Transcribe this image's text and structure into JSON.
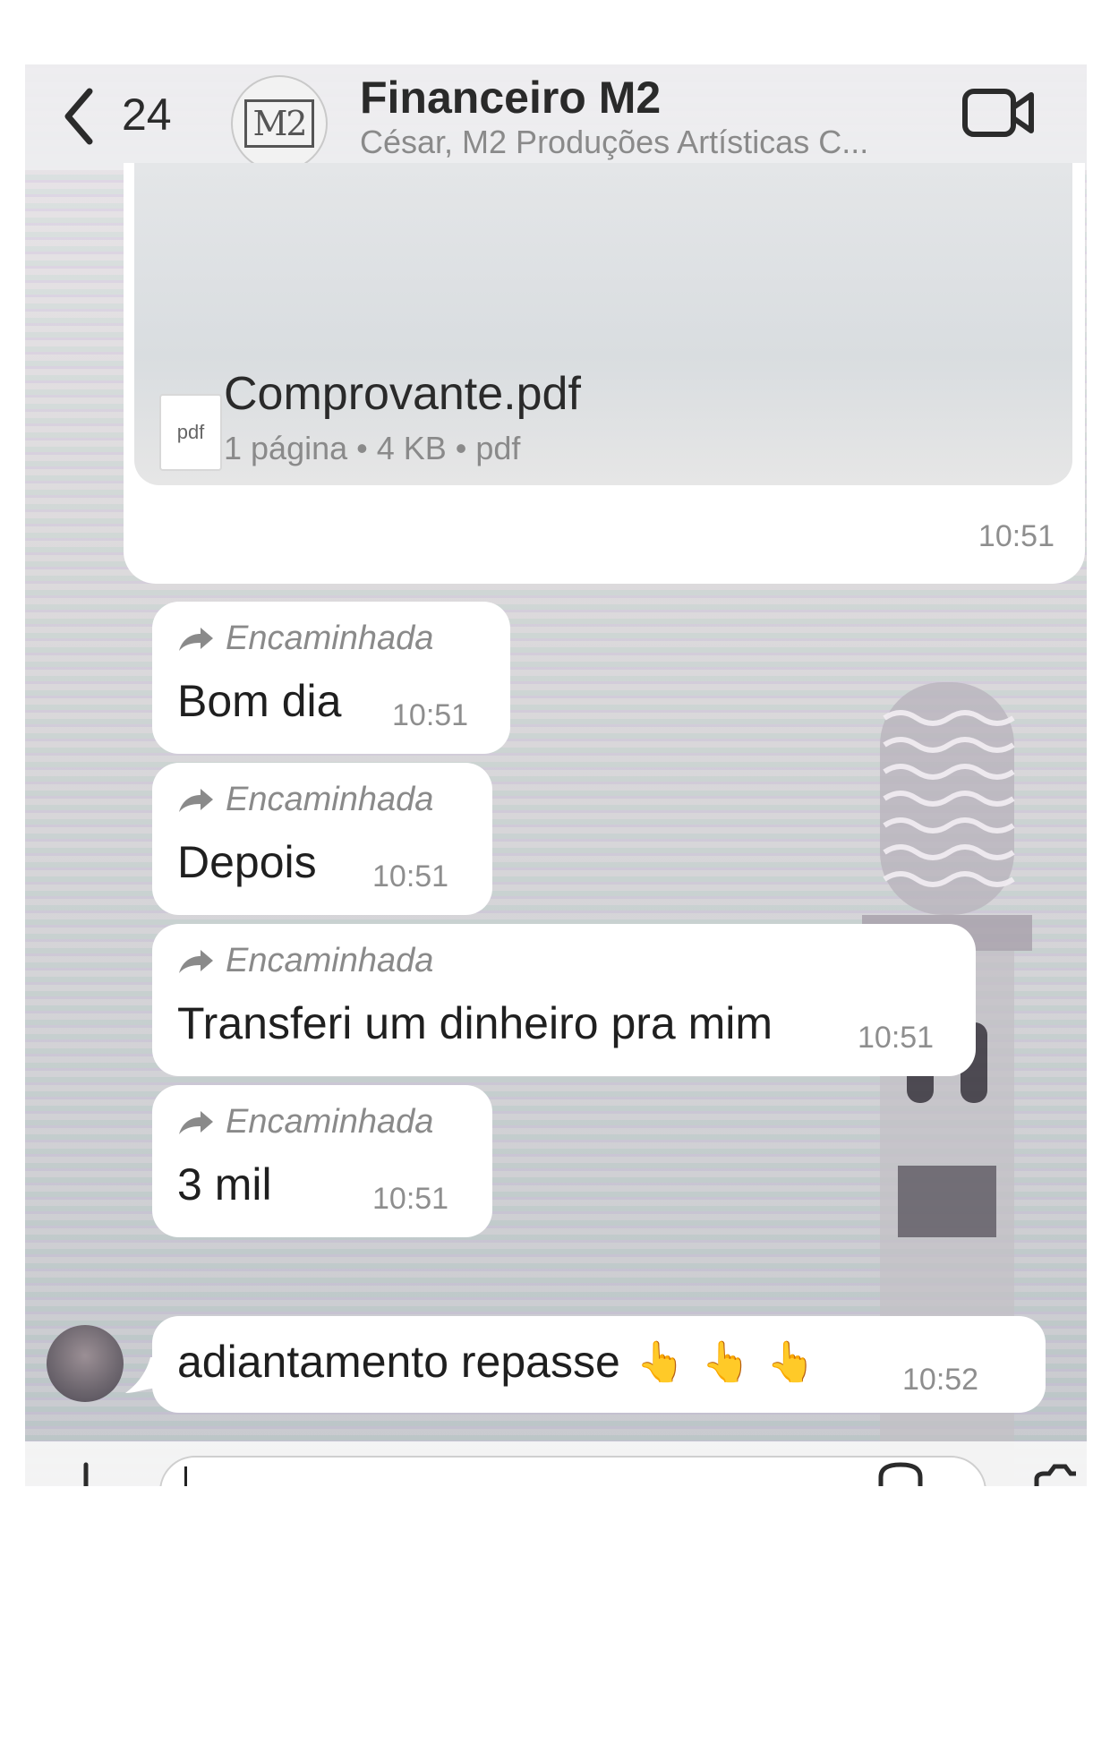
{
  "header": {
    "back_count": "24",
    "avatar_text": "M2",
    "title": "Financeiro M2",
    "subtitle": "César, M2 Produções Artísticas C..."
  },
  "messages": {
    "file": {
      "name": "Comprovante.pdf",
      "meta": "1 página • 4 KB • pdf",
      "icon_label": "pdf",
      "time": "10:51"
    },
    "items": [
      {
        "forward_label": "Encaminhada",
        "text": "Bom dia",
        "time": "10:51"
      },
      {
        "forward_label": "Encaminhada",
        "text": "Depois",
        "time": "10:51"
      },
      {
        "forward_label": "Encaminhada",
        "text": "Transferi um dinheiro pra mim",
        "time": "10:51"
      },
      {
        "forward_label": "Encaminhada",
        "text": "3 mil",
        "time": "10:51"
      }
    ],
    "last": {
      "text": "adiantamento repasse",
      "emoji": "👆",
      "time": "10:52"
    }
  },
  "icons": [
    "back-chevron-icon",
    "video-call-icon",
    "forward-arrow-icon",
    "plus-icon",
    "sticker-icon",
    "camera-icon"
  ],
  "colors": {
    "bubble": "#ffffff",
    "meta_text": "#8e8e8e",
    "title_text": "#2a2a2a"
  }
}
